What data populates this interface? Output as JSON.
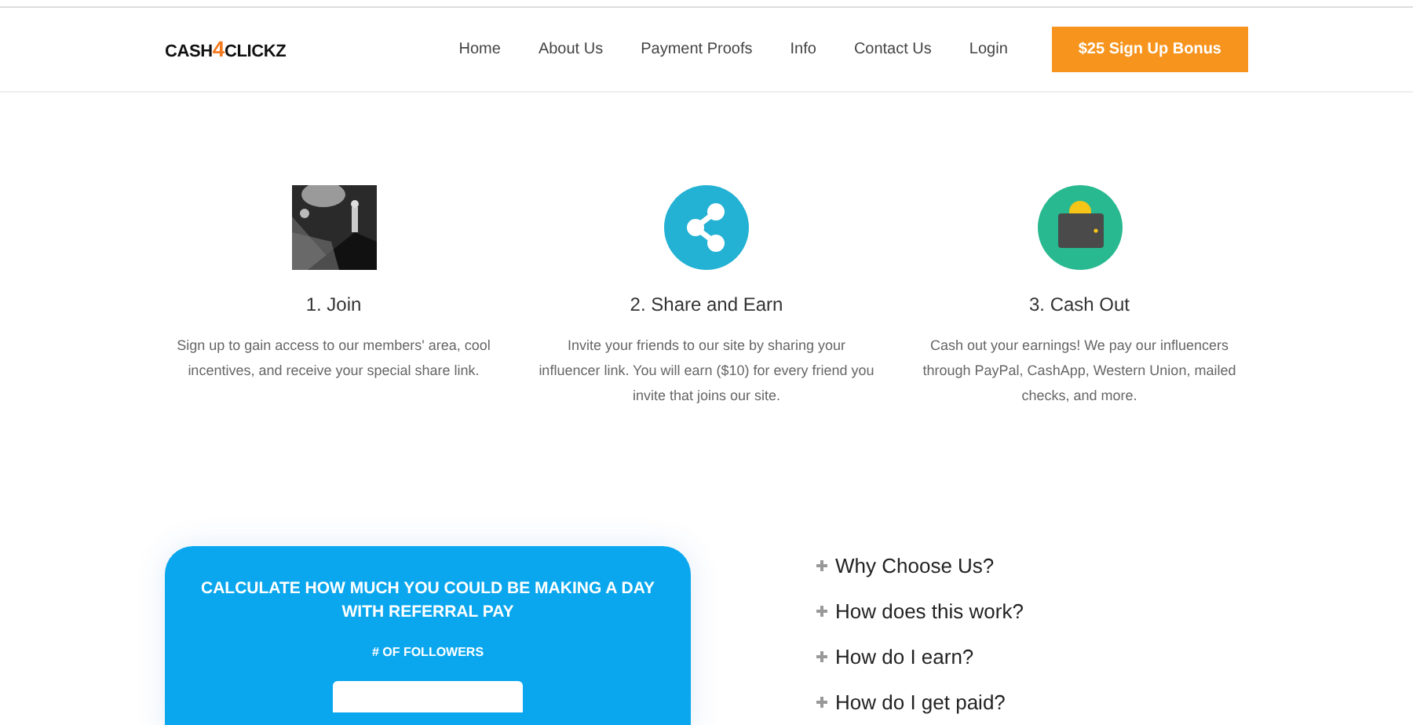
{
  "logo": {
    "parts": [
      {
        "text": "CASH",
        "accent": false
      },
      {
        "text": "4",
        "accent": true
      },
      {
        "text": "CLICKZ",
        "accent": false
      }
    ]
  },
  "nav": {
    "links": [
      "Home",
      "About Us",
      "Payment Proofs",
      "Info",
      "Contact Us",
      "Login"
    ],
    "cta": "$25 Sign Up Bonus"
  },
  "steps": [
    {
      "kind": "picture",
      "title": "1. Join",
      "text": "Sign up to gain access to our members' area, cool incentives, and receive your special share link."
    },
    {
      "kind": "share",
      "title": "2. Share and Earn",
      "text": "Invite your friends to our site by sharing your influencer link. You will earn ($10) for every friend you invite that joins our site."
    },
    {
      "kind": "wallet",
      "title": "3. Cash Out",
      "text": "Cash out your earnings! We pay our influencers through PayPal, CashApp, Western Union, mailed checks, and more."
    }
  ],
  "calculator": {
    "title": "CALCULATE HOW MUCH YOU COULD BE MAKING A DAY WITH REFERRAL PAY",
    "field_label": "# OF FOLLOWERS"
  },
  "faq": [
    "Why Choose Us?",
    "How does this work?",
    "How do I earn?",
    "How do I get paid?"
  ]
}
